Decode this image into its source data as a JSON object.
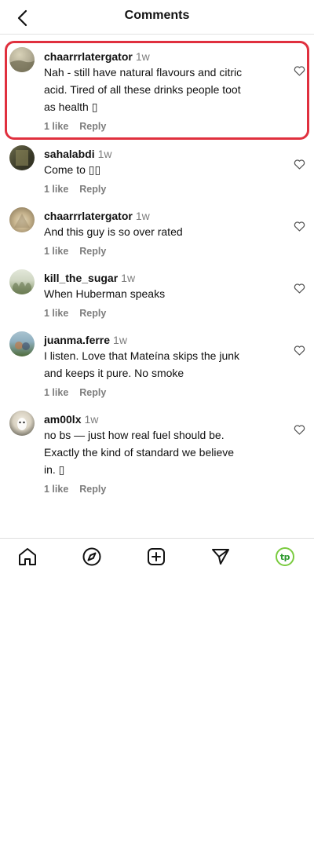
{
  "header": {
    "title": "Comments"
  },
  "comments": [
    {
      "username": "chaarrrlatergator",
      "time": "1w",
      "lines": [
        "Nah - still have natural flavours and citric",
        "acid. Tired of all these drinks people toot",
        "as health ▯"
      ],
      "likes": "1 like",
      "reply": "Reply",
      "highlighted": true,
      "avatar_colors": [
        "#b8b29a",
        "#7f7a63"
      ]
    },
    {
      "username": "sahalabdi",
      "time": "1w",
      "lines": [
        "Come to ▯▯"
      ],
      "likes": "1 like",
      "reply": "Reply",
      "avatar_colors": [
        "#6b6a4a",
        "#2d2d21"
      ]
    },
    {
      "username": "chaarrrlatergator",
      "time": "1w",
      "lines": [
        "And this guy is so over rated"
      ],
      "likes": "1 like",
      "reply": "Reply",
      "avatar_colors": [
        "#c8b58f",
        "#7b6a4c"
      ]
    },
    {
      "username": "kill_the_sugar",
      "time": "1w",
      "lines": [
        "When Huberman speaks"
      ],
      "likes": "1 like",
      "reply": "Reply",
      "avatar_colors": [
        "#cfd6c2",
        "#7d8f63"
      ]
    },
    {
      "username": "juanma.ferre",
      "time": "1w",
      "lines": [
        "I listen. Love that Mateína skips the junk",
        "and keeps it pure. No smoke"
      ],
      "likes": "1 like",
      "reply": "Reply",
      "avatar_colors": [
        "#8fb0c0",
        "#4f6b3a"
      ]
    },
    {
      "username": "am00lx",
      "time": "1w",
      "lines": [
        "no bs — just how real fuel should be.",
        "Exactly the kind of standard we believe",
        "in. ▯"
      ],
      "likes": "1 like",
      "reply": "Reply",
      "avatar_colors": [
        "#d9d2c2",
        "#3b3a2f"
      ]
    }
  ],
  "bottom_nav": {
    "items": [
      {
        "name": "home-icon"
      },
      {
        "name": "explore-icon"
      },
      {
        "name": "create-icon"
      },
      {
        "name": "direct-messages-icon"
      },
      {
        "name": "profile-icon",
        "label": "tp",
        "color": "#7acb3f"
      }
    ]
  },
  "colors": {
    "highlight": "#e0303e",
    "muted_text": "#7d7d7d",
    "profile_accent": "#7acb3f"
  }
}
